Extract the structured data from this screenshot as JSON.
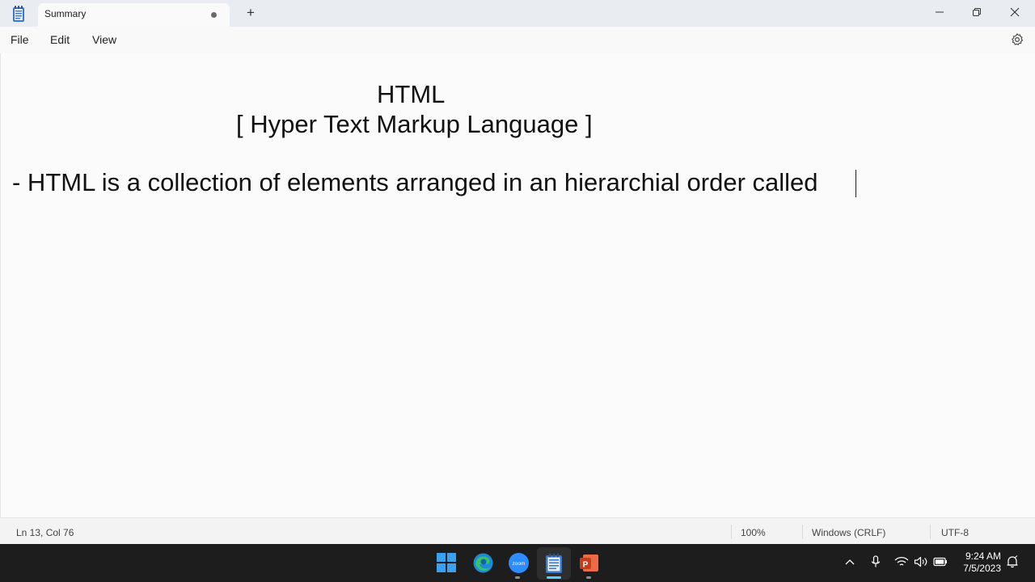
{
  "window": {
    "tab_title": "Summary",
    "new_tab_symbol": "+"
  },
  "menu": {
    "file": "File",
    "edit": "Edit",
    "view": "View"
  },
  "document": {
    "lines": [
      "HTML",
      "[ Hyper Text Markup Language ]",
      "- HTML is a collection of elements arranged in an hierarchial order called "
    ]
  },
  "status": {
    "position": "Ln 13, Col 76",
    "zoom": "100%",
    "line_ending": "Windows (CRLF)",
    "encoding": "UTF-8"
  },
  "taskbar": {
    "apps": [
      "start-icon",
      "edge-icon",
      "zoom-icon",
      "notepad-icon",
      "powerpoint-icon"
    ],
    "zoom_label": "zoom",
    "ppt_letter": "P",
    "time": "9:24 AM",
    "date": "7/5/2023"
  },
  "colors": {
    "taskbar_bg": "#1d1d1d",
    "titlebar_bg": "#e9edf1",
    "editor_bg": "#fbfbfb",
    "start_blue": "#3aa0f0",
    "zoom_blue": "#2d8cff",
    "ppt_orange": "#d24726"
  }
}
